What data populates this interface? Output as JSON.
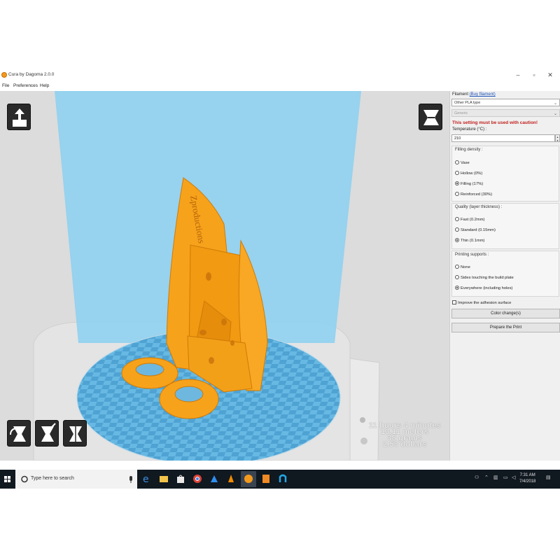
{
  "window": {
    "title": "Cura by Dagoma 2.0.0",
    "controls": [
      "–",
      "▫",
      "✕"
    ]
  },
  "menu": [
    "File",
    "Preferences",
    "Help"
  ],
  "viewport": {
    "model_text": "Zproductions",
    "colors": {
      "model": "#f7a21b",
      "volume": "#8fd0ef",
      "plate": "#5fb6e6",
      "background": "#dcdcdc"
    },
    "stats": {
      "line1": "11 hours 4 minutes",
      "line2": "13.11 meters",
      "line3": "38 grams",
      "line4": "2.53 dollars"
    }
  },
  "panel": {
    "filament_label": "Filament",
    "filament_link": "(Buy filament)",
    "filament_value": "Other PLA type",
    "filament_sub_value": "Generic",
    "warning": "This setting must be used with caution!",
    "temperature_label": "Temperature (°C) :",
    "temperature_value": "210",
    "density": {
      "title": "Filling density :",
      "options": [
        "Vase",
        "Hollow (0%)",
        "Filling (17%)",
        "Reinforced (30%)"
      ],
      "selected": 2
    },
    "quality": {
      "title": "Quality (layer thickness) :",
      "options": [
        "Fast (0.2mm)",
        "Standard (0.15mm)",
        "Thin (0.1mm)"
      ],
      "selected": 2
    },
    "supports": {
      "title": "Printing supports :",
      "options": [
        "None",
        "Sides touching the build plate",
        "Everywhere (including holes)"
      ],
      "selected": 2
    },
    "adhesion_label": "Improve the adhesion surface",
    "color_button": "Color change(s)",
    "prepare_button": "Prepare the Print"
  },
  "taskbar": {
    "search_placeholder": "Type here to search",
    "time": "7:31 AM",
    "date": "7/4/2018"
  }
}
